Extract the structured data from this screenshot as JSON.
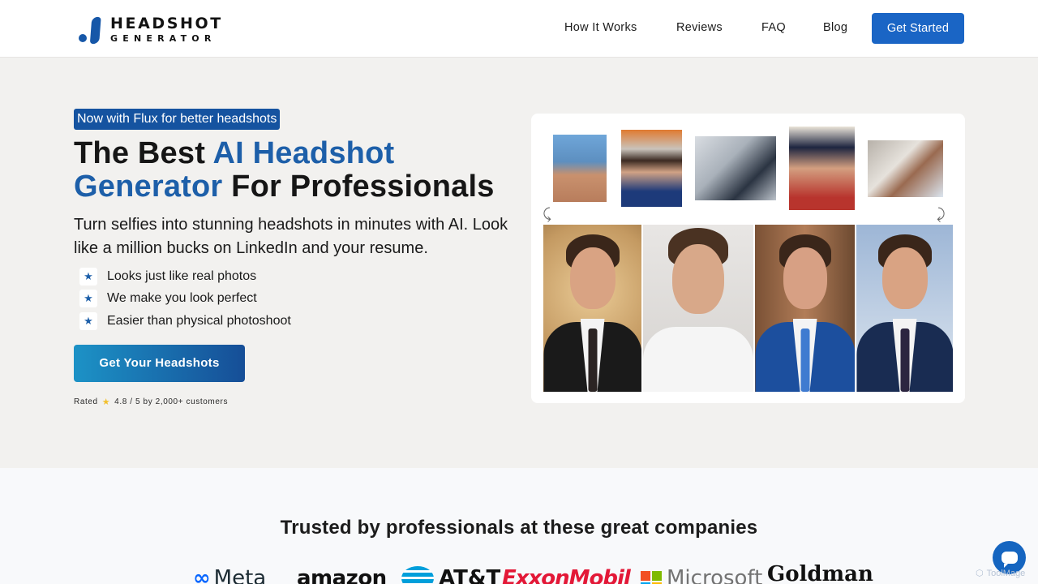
{
  "header": {
    "logo_top": "HEADSHOT",
    "logo_bottom": "GENERATOR",
    "nav": [
      "How It Works",
      "Reviews",
      "FAQ",
      "Blog"
    ],
    "cta": "Get Started"
  },
  "hero": {
    "badge": "Now with Flux for better headshots",
    "title_part1": "The Best ",
    "title_highlight": "AI Headshot Generator",
    "title_part2": " For Professionals",
    "title_line1_blue": "AI Headshot",
    "title_line2_blue": "Generator",
    "title_line2_rest": " For Professionals",
    "subtitle": "Turn selfies into stunning headshots in minutes with AI. Look like a million bucks on LinkedIn and your resume.",
    "features": [
      "Looks just like real photos",
      "We make you look perfect",
      "Easier than physical photoshoot"
    ],
    "cta": "Get Your Headshots",
    "rating_prefix": "Rated",
    "rating_text": "4.8 / 5 by 2,000+ customers"
  },
  "trusted": {
    "title": "Trusted by professionals at these great companies",
    "companies": [
      "Meta",
      "amazon",
      "AT&T",
      "ExxonMobil",
      "Microsoft",
      "Goldman"
    ]
  },
  "watermark": "ToolMage",
  "colors": {
    "brand_blue": "#1a65c5",
    "title_blue": "#1d5fa9",
    "badge_bg": "#1553a0"
  }
}
